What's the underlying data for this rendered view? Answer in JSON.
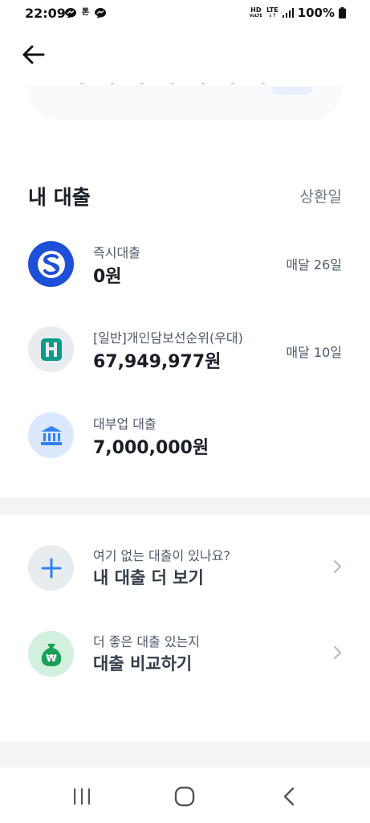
{
  "status_bar": {
    "time": "22:09",
    "left_badge": "톤",
    "hd_top": "HD",
    "hd_bottom": "VoLTE",
    "lte": "LTE",
    "battery": "100%"
  },
  "header": {
    "back_icon": "arrow-left-icon"
  },
  "loans": {
    "section_title": "내 대출",
    "section_right": "상환일",
    "items": [
      {
        "name": "즉시대출",
        "amount": "0원",
        "due": "매달 26일",
        "icon": "shinhan-bank-icon",
        "icon_bg": "#1e4fd8"
      },
      {
        "name": "[일반]개인담보선순위(우대)",
        "amount": "67,949,977원",
        "due": "매달 10일",
        "icon": "hana-bank-icon",
        "icon_bg": "#e9ecef"
      },
      {
        "name": "대부업 대출",
        "amount": "7,000,000원",
        "due": "",
        "icon": "bank-building-icon",
        "icon_bg": "#dbe8fd"
      }
    ]
  },
  "actions": [
    {
      "subtitle": "여기 없는 대출이 있나요?",
      "title": "내 대출 더 보기",
      "icon": "plus-icon",
      "icon_bg": "#e9ecef"
    },
    {
      "subtitle": "더 좋은 대출 있는지",
      "title": "대출 비교하기",
      "icon": "money-bag-icon",
      "icon_bg": "#d3f0df"
    }
  ],
  "nav": {
    "recent": "recent-apps-icon",
    "home": "home-icon",
    "back": "back-icon"
  },
  "colors": {
    "accent_blue": "#3182f6",
    "text_primary": "#1a1f27",
    "text_secondary": "#4e5968",
    "divider": "#f2f4f6"
  }
}
